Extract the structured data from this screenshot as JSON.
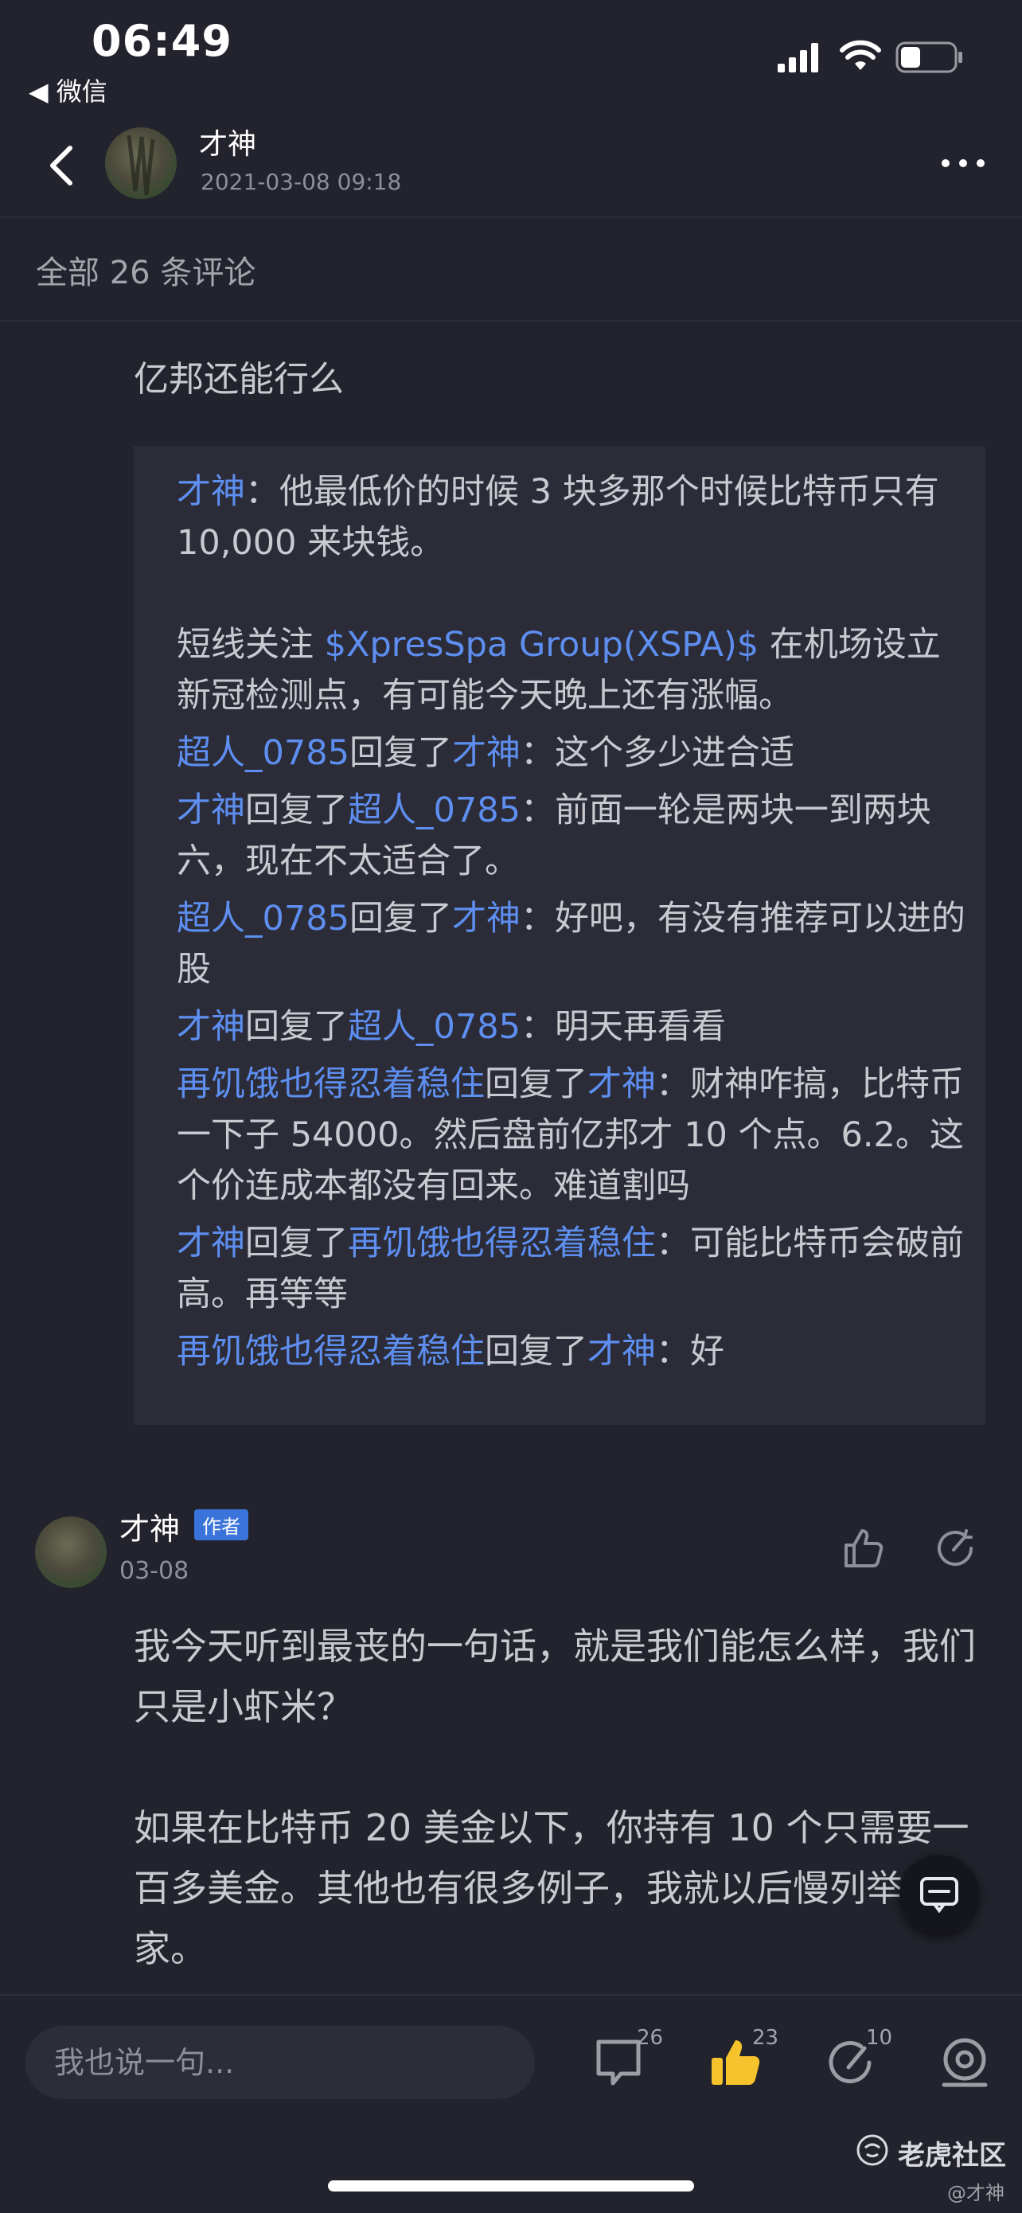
{
  "status_bar": {
    "time": "06:49",
    "back_app": "◀ 微信"
  },
  "header": {
    "author": "才神",
    "timestamp": "2021-03-08 09:18"
  },
  "comments_count_label": "全部 26 条评论",
  "question": "亿邦还能行么",
  "replies": [
    {
      "from": "才神",
      "to": "",
      "text": "他最低价的时候 3 块多那个时候比特币只有 10,000 来块钱。"
    },
    {
      "pre": "短线关注 ",
      "ticker": "$XpresSpa Group(XSPA)$",
      "post": " 在机场设立新冠检测点，有可能今天晚上还有涨幅。"
    },
    {
      "from": "超人_0785",
      "to": "才神",
      "text": "这个多少进合适"
    },
    {
      "from": "才神",
      "to": "超人_0785",
      "text": "前面一轮是两块一到两块六，现在不太适合了。"
    },
    {
      "from": "超人_0785",
      "to": "才神",
      "text": "好吧，有没有推荐可以进的股"
    },
    {
      "from": "才神",
      "to": "超人_0785",
      "text": "明天再看看"
    },
    {
      "from": "再饥饿也得忍着稳住",
      "to": "才神",
      "text": "财神咋搞，比特币一下子 54000。然后盘前亿邦才 10 个点。6.2。这个价连成本都没有回来。难道割吗"
    },
    {
      "from": "才神",
      "to": "再饥饿也得忍着稳住",
      "text": "可能比特币会破前高。再等等"
    },
    {
      "from": "再饥饿也得忍着稳住",
      "to": "才神",
      "text": "好"
    }
  ],
  "reply_verb": "回复了",
  "colon": "：",
  "comment": {
    "name": "才神",
    "badge": "作者",
    "date": "03-08",
    "paragraph1": "我今天听到最丧的一句话，就是我们能怎么样，我们只是小虾米？",
    "paragraph2": "如果在比特币 20 美金以下，你持有 10 个只需要一百多美金。其他也有很多例子，我就以后慢列举给大家。"
  },
  "bottom_bar": {
    "input_placeholder": "我也说一句...",
    "comments_count": "26",
    "likes_count": "23",
    "shares_count": "10"
  },
  "brand": "老虎社区",
  "watermark": "@才神",
  "colors": {
    "link": "#5d8ef0",
    "background": "#22232c",
    "like_active": "#f5c32b",
    "badge": "#3a73d9"
  }
}
